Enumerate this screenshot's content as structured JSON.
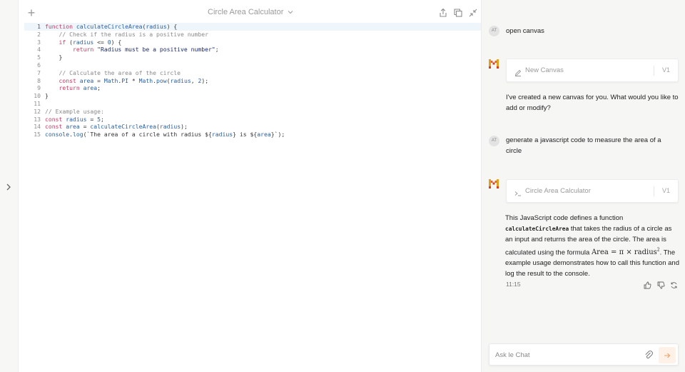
{
  "editor": {
    "title": "Circle Area Calculator",
    "code_lines": [
      [
        [
          "kw",
          "function "
        ],
        [
          "fn",
          "calculateCircleArea"
        ],
        [
          "pl",
          "("
        ],
        [
          "id",
          "radius"
        ],
        [
          "pl",
          ") {"
        ]
      ],
      [
        [
          "pl",
          "    "
        ],
        [
          "cm",
          "// Check if the radius is a positive number"
        ]
      ],
      [
        [
          "pl",
          "    "
        ],
        [
          "kw",
          "if"
        ],
        [
          "pl",
          " ("
        ],
        [
          "id",
          "radius"
        ],
        [
          "pl",
          " <= "
        ],
        [
          "nm",
          "0"
        ],
        [
          "pl",
          ") {"
        ]
      ],
      [
        [
          "pl",
          "        "
        ],
        [
          "kw",
          "return "
        ],
        [
          "st",
          "\"Radius must be a positive number\""
        ],
        [
          "pl",
          ";"
        ]
      ],
      [
        [
          "pl",
          "    }"
        ]
      ],
      [
        [
          "pl",
          ""
        ]
      ],
      [
        [
          "pl",
          "    "
        ],
        [
          "cm",
          "// Calculate the area of the circle"
        ]
      ],
      [
        [
          "pl",
          "    "
        ],
        [
          "kw",
          "const "
        ],
        [
          "id",
          "area"
        ],
        [
          "pl",
          " = "
        ],
        [
          "id",
          "Math"
        ],
        [
          "pl",
          "."
        ],
        [
          "id",
          "PI"
        ],
        [
          "pl",
          " * "
        ],
        [
          "id",
          "Math"
        ],
        [
          "pl",
          "."
        ],
        [
          "fn",
          "pow"
        ],
        [
          "pl",
          "("
        ],
        [
          "id",
          "radius"
        ],
        [
          "pl",
          ", "
        ],
        [
          "nm",
          "2"
        ],
        [
          "pl",
          ");"
        ]
      ],
      [
        [
          "pl",
          "    "
        ],
        [
          "kw",
          "return "
        ],
        [
          "id",
          "area"
        ],
        [
          "pl",
          ";"
        ]
      ],
      [
        [
          "pl",
          "}"
        ]
      ],
      [
        [
          "pl",
          ""
        ]
      ],
      [
        [
          "cm",
          "// Example usage:"
        ]
      ],
      [
        [
          "kw",
          "const "
        ],
        [
          "id",
          "radius"
        ],
        [
          "pl",
          " = "
        ],
        [
          "nm",
          "5"
        ],
        [
          "pl",
          ";"
        ]
      ],
      [
        [
          "kw",
          "const "
        ],
        [
          "id",
          "area"
        ],
        [
          "pl",
          " = "
        ],
        [
          "fn",
          "calculateCircleArea"
        ],
        [
          "pl",
          "("
        ],
        [
          "id",
          "radius"
        ],
        [
          "pl",
          ");"
        ]
      ],
      [
        [
          "id",
          "console"
        ],
        [
          "pl",
          "."
        ],
        [
          "fn",
          "log"
        ],
        [
          "pl",
          "(`The area of a circle with radius ${"
        ],
        [
          "id",
          "radius"
        ],
        [
          "pl",
          "} is ${"
        ],
        [
          "id",
          "area"
        ],
        [
          "pl",
          "}`);"
        ]
      ]
    ]
  },
  "chat": {
    "messages": {
      "user1": {
        "avatar": "AT",
        "text": "open canvas"
      },
      "bot1": {
        "card_title": "New Canvas",
        "card_version": "V1",
        "text": "I've created a new canvas for you. What would you like to add or modify?"
      },
      "user2": {
        "avatar": "AT",
        "text": "generate a javascript code to measure the area of a circle"
      },
      "bot2": {
        "card_title": "Circle Area Calculator",
        "card_version": "V1",
        "p1": "This JavaScript code defines a function",
        "code": "calculateCircleArea",
        "p2": " that takes the radius of a circle as an input and returns the area of the circle. The area is calculated using the formula ",
        "formula_area": "Area",
        "formula_eq": " = π × ",
        "formula_radius": "radius",
        "formula_exp": "2",
        "p3": ". The example usage demonstrates how to call this function and log the result to the console.",
        "timestamp": "11:15"
      }
    },
    "input": {
      "placeholder": "Ask le Chat"
    }
  },
  "colors": {
    "brand": "#f0a060",
    "keyword": "#c13c62",
    "identifier": "#2a5f9e",
    "comment": "#8a8a8a",
    "string": "#1b2b6b"
  }
}
